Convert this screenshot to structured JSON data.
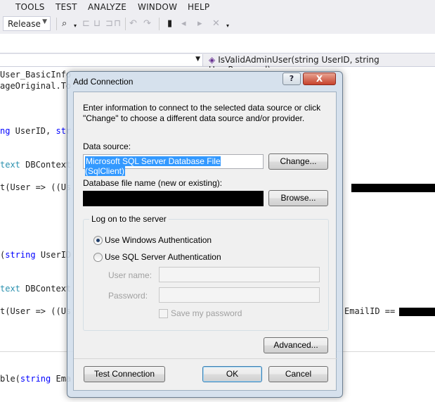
{
  "menu": {
    "tools": "TOOLS",
    "test": "TEST",
    "analyze": "ANALYZE",
    "window": "WINDOW",
    "help": "HELP"
  },
  "toolbar": {
    "config_value": "Release"
  },
  "navbar": {
    "member": "IsValidAdminUser(string UserID, string UserPassword)"
  },
  "code": {
    "l1": "User_BasicInfo",
    "l2": "ageOriginal.To",
    "l3_kw": "ng",
    "l3_rest": " UserID, ",
    "l3_kw2": "str",
    "l4_kw": "text",
    "l4_rest": " DBContext",
    "l5": "t(User => ((Us",
    "l6_a": "(",
    "l6_kw": "string",
    "l6_rest": " UserID",
    "l7_kw": "text",
    "l7_rest": " DBContext",
    "l8": "t(User => ((Us",
    "l8_right": "EmailID ==",
    "l9_a": "ble(",
    "l9_kw": "string",
    "l9_rest": " Ema"
  },
  "dialog": {
    "title": "Add Connection",
    "help": "?",
    "close": "X",
    "intro": "Enter information to connect to the selected data source or click \"Change\" to choose a different data source and/or provider.",
    "data_source_label": "Data source:",
    "data_source_value": "Microsoft SQL Server Database File (SqlClient)",
    "change_button": "Change...",
    "db_file_label": "Database file name (new or existing):",
    "browse_button": "Browse...",
    "logon_group": "Log on to the server",
    "windows_auth": "Use Windows Authentication",
    "sql_auth": "Use SQL Server Authentication",
    "user_name_label": "User name:",
    "password_label": "Password:",
    "save_password": "Save my password",
    "advanced_button": "Advanced...",
    "test_button": "Test Connection",
    "ok_button": "OK",
    "cancel_button": "Cancel"
  },
  "colors": {
    "accent_selection": "#3399ff",
    "keyword": "#0000ff",
    "type": "#2b91af"
  }
}
